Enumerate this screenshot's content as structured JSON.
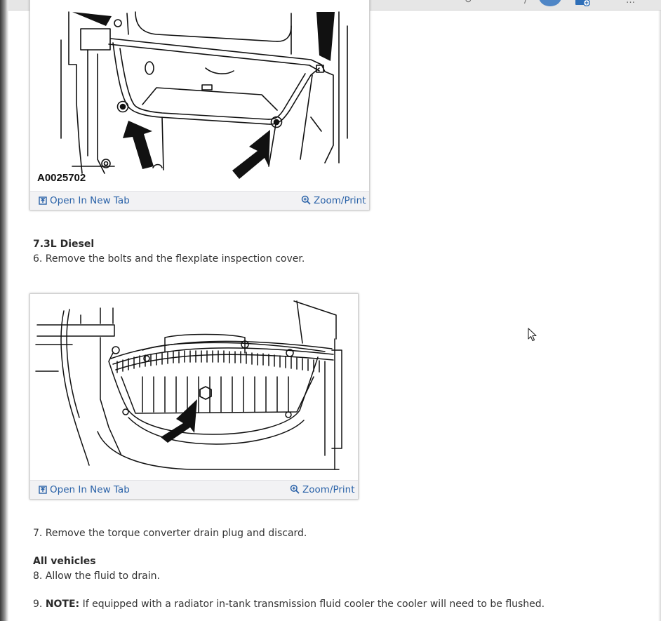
{
  "figure1": {
    "label": "A0025702",
    "open_tab": "Open In New Tab",
    "zoom_print": "Zoom/Print"
  },
  "section_73l": {
    "heading": "7.3L Diesel",
    "step6": "6. Remove the bolts and the flexplate inspection cover."
  },
  "figure2": {
    "open_tab": "Open In New Tab",
    "zoom_print": "Zoom/Print"
  },
  "step7": "7. Remove the torque converter drain plug and discard.",
  "section_all": {
    "heading": "All vehicles",
    "step8": "8. Allow the fluid to drain.",
    "step9_number": "9.",
    "step9_note": "NOTE:",
    "step9_text": "If equipped with a radiator in-tank transmission fluid cooler the cooler will need to be flushed."
  },
  "colors": {
    "link": "#2a62a8",
    "avatar": "#4f86c6",
    "bar_bg": "#f2f2f4"
  }
}
